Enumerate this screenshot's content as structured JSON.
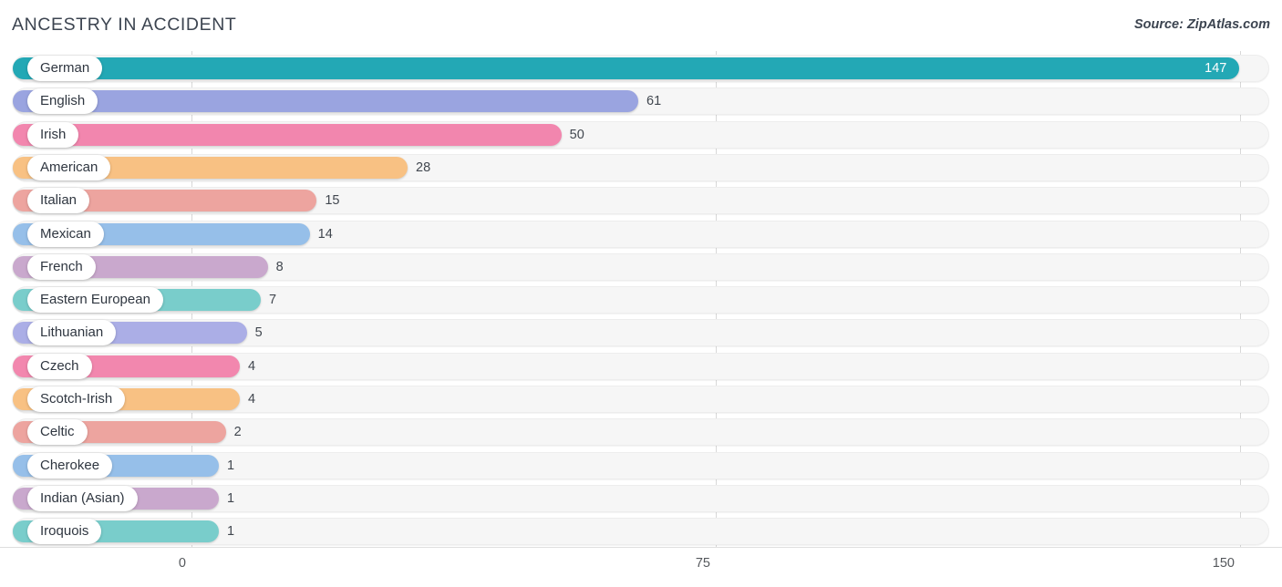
{
  "header": {
    "title": "ANCESTRY IN ACCIDENT",
    "source": "Source: ZipAtlas.com"
  },
  "chart_data": {
    "type": "bar",
    "orientation": "horizontal",
    "title": "ANCESTRY IN ACCIDENT",
    "xlabel": "",
    "ylabel": "",
    "xlim": [
      0,
      150
    ],
    "xticks": [
      0,
      75,
      150
    ],
    "xtick_labels": [
      "0",
      "75",
      "150"
    ],
    "grid": true,
    "legend": false,
    "categories": [
      "German",
      "English",
      "Irish",
      "American",
      "Italian",
      "Mexican",
      "French",
      "Eastern European",
      "Lithuanian",
      "Czech",
      "Scotch-Irish",
      "Celtic",
      "Cherokee",
      "Indian (Asian)",
      "Iroquois"
    ],
    "values": [
      147,
      61,
      50,
      28,
      15,
      14,
      8,
      7,
      5,
      4,
      4,
      2,
      1,
      1,
      1
    ],
    "value_labels": [
      "147",
      "61",
      "50",
      "28",
      "15",
      "14",
      "8",
      "7",
      "5",
      "4",
      "4",
      "2",
      "1",
      "1",
      "1"
    ],
    "colors": [
      "#23a8b5",
      "#9aa4e0",
      "#f286ae",
      "#f8c183",
      "#eda49f",
      "#96bfe9",
      "#c9a8cd",
      "#79cdcb",
      "#abaee6",
      "#f287ae",
      "#f8c183",
      "#eda49f",
      "#96bfe9",
      "#c9a8cd",
      "#79cdcb"
    ],
    "track_color": "#f6f6f6",
    "label_pill_color": "#ffffff"
  }
}
